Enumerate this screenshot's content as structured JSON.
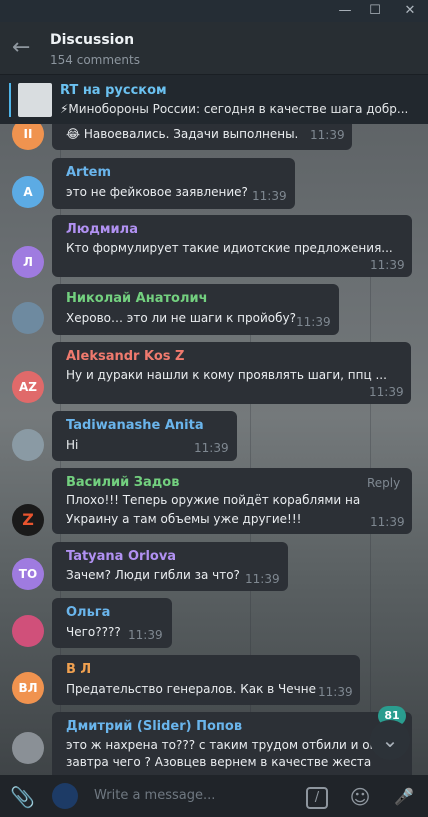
{
  "window": {
    "minimize": "—",
    "maximize": "☐",
    "close": "✕"
  },
  "header": {
    "back": "←",
    "title": "Discussion",
    "subtitle": "154 comments"
  },
  "pinned": {
    "name": "RT на русском",
    "text": "⚡Минобороны России: сегодня в качестве шага добр..."
  },
  "messages": [
    {
      "initials": "II",
      "avatar_color": "#f0934f",
      "author": "",
      "author_color": "#f0934f",
      "lines": [
        "😂 Навоевались. Задачи выполнены."
      ],
      "time": "11:39"
    },
    {
      "initials": "A",
      "avatar_color": "#5cabe4",
      "author": "Artem",
      "author_color": "#6ab5ec",
      "lines": [
        "это не фейковое заявление?"
      ],
      "time": "11:39"
    },
    {
      "initials": "Л",
      "avatar_color": "#9f7be0",
      "author": "Людмила",
      "author_color": "#b191f2",
      "lines": [
        "Кто формулирует такие идиотские предложения..."
      ],
      "time": "11:39"
    },
    {
      "initials": "",
      "avatar_color": "#6e8aa0",
      "author": "Николай Анатолич",
      "author_color": "#73d07f",
      "lines": [
        "Херово… это ли не шаги к пройобу?"
      ],
      "time": "11:39"
    },
    {
      "initials": "AZ",
      "avatar_color": "#e06a6a",
      "author": "Aleksandr Kos Z",
      "author_color": "#f07a6e",
      "lines": [
        "Ну и дураки нашли к кому проявлять шаги, ппц ..."
      ],
      "time": "11:39"
    },
    {
      "initials": "",
      "avatar_color": "#8a9aa4",
      "author": "Tadiwanashe Anita",
      "author_color": "#6ab5ec",
      "lines": [
        "Hi"
      ],
      "time": "11:39"
    },
    {
      "initials": "Z",
      "avatar_color": "#1a1a1a",
      "author": "Василий Задов",
      "author_color": "#73d07f",
      "lines": [
        "Плохо!!! Теперь оружие пойдёт кораблями на",
        "Украину а там объемы уже другие!!!"
      ],
      "time": "11:39",
      "reply": "Reply"
    },
    {
      "initials": "TO",
      "avatar_color": "#9f7be0",
      "author": "Tatyana Orlova",
      "author_color": "#b191f2",
      "lines": [
        "Зачем? Люди гибли за что?"
      ],
      "time": "11:39"
    },
    {
      "initials": "",
      "avatar_color": "#d0507a",
      "author": "Ольга",
      "author_color": "#6ab5ec",
      "lines": [
        "Чего????"
      ],
      "time": "11:39"
    },
    {
      "initials": "ВЛ",
      "avatar_color": "#f0934f",
      "author": "В Л",
      "author_color": "#f0a050",
      "lines": [
        "Предательство генералов. Как в Чечне"
      ],
      "time": "11:39"
    },
    {
      "initials": "",
      "avatar_color": "#8a9096",
      "author": "Дмитрий (Slider) Попов",
      "author_color": "#6ab5ec",
      "lines": [
        "это ж нахрена то??? с таким трудом отбили и опа",
        "завтра чего ? Азовцев вернем в качестве жеста"
      ],
      "time": ""
    }
  ],
  "scroll": {
    "badge": "81",
    "icon": "⌄"
  },
  "composer": {
    "placeholder": "Write a message...",
    "attach": "📎",
    "command": "/",
    "emoji": "☺",
    "mic": "🎤"
  }
}
